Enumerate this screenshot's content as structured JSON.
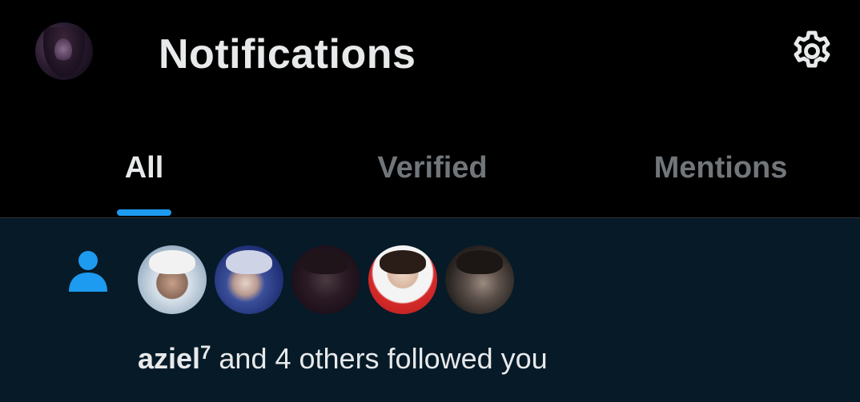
{
  "header": {
    "title": "Notifications",
    "avatar_icon": "profile-avatar",
    "settings_icon": "gear-icon"
  },
  "tabs": [
    {
      "label": "All",
      "active": true
    },
    {
      "label": "Verified",
      "active": false
    },
    {
      "label": "Mentions",
      "active": false
    }
  ],
  "notification": {
    "type_icon": "person-icon",
    "name": "aziel",
    "name_superscript": "7",
    "rest_text": " and 4 others followed you",
    "avatar_count": 5
  },
  "colors": {
    "background": "#000000",
    "accent": "#1d9bf0",
    "notification_bg": "#061a28",
    "text_primary": "#e7e9ea",
    "text_secondary": "#71767b"
  }
}
